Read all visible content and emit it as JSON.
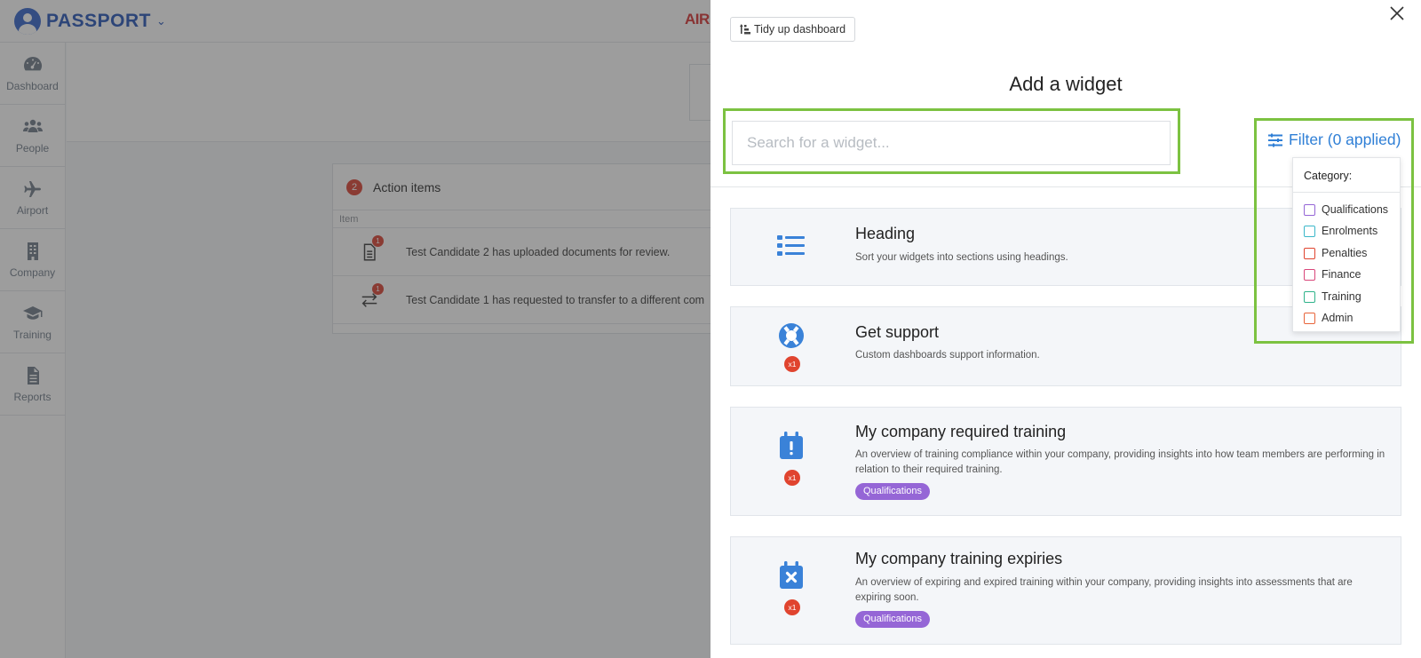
{
  "app": {
    "name": "PASSPORT",
    "brand_snippet_a": "AIR",
    "brand_snippet_b": "",
    "nav": [
      {
        "label": "Dashboard",
        "icon": "gauge-icon"
      },
      {
        "label": "People",
        "icon": "people-icon"
      },
      {
        "label": "Airport",
        "icon": "plane-icon"
      },
      {
        "label": "Company",
        "icon": "building-icon"
      },
      {
        "label": "Training",
        "icon": "graduation-cap-icon"
      },
      {
        "label": "Reports",
        "icon": "document-icon"
      }
    ],
    "action_items": {
      "count": "2",
      "title": "Action items",
      "column": "Item",
      "rows": [
        {
          "badge": "1",
          "icon": "document-icon",
          "text": "Test Candidate 2 has uploaded documents for review."
        },
        {
          "badge": "1",
          "icon": "transfer-icon",
          "text": "Test Candidate 1 has requested to transfer to a different com"
        }
      ]
    }
  },
  "panel": {
    "tidy_label": "Tidy up dashboard",
    "title": "Add a widget",
    "search_placeholder": "Search for a widget...",
    "filter_label": "Filter (0 applied)",
    "category_label": "Category:",
    "categories": [
      {
        "label": "Qualifications",
        "color": "#9566d6"
      },
      {
        "label": "Enrolments",
        "color": "#3bb7c9"
      },
      {
        "label": "Penalties",
        "color": "#e0442f"
      },
      {
        "label": "Finance",
        "color": "#d9467a"
      },
      {
        "label": "Training",
        "color": "#2fb38a"
      },
      {
        "label": "Admin",
        "color": "#e8643a"
      }
    ],
    "widgets": [
      {
        "title": "Heading",
        "description": "Sort your widgets into sections using headings.",
        "icon": "list-icon",
        "badge": "",
        "tag": ""
      },
      {
        "title": "Get support",
        "description": "Custom dashboards support information.",
        "icon": "lifebuoy-icon",
        "badge": "x1",
        "tag": ""
      },
      {
        "title": "My company required training",
        "description": "An overview of training compliance within your company, providing insights into how team members are performing in relation to their required training.",
        "icon": "calendar-exclamation-icon",
        "badge": "x1",
        "tag": "Qualifications"
      },
      {
        "title": "My company training expiries",
        "description": "An overview of expiring and expired training within your company, providing insights into assessments that are expiring soon.",
        "icon": "calendar-x-icon",
        "badge": "x1",
        "tag": "Qualifications"
      }
    ],
    "accent_color": "#2f7fd6",
    "highlight_color": "#7cc241"
  }
}
